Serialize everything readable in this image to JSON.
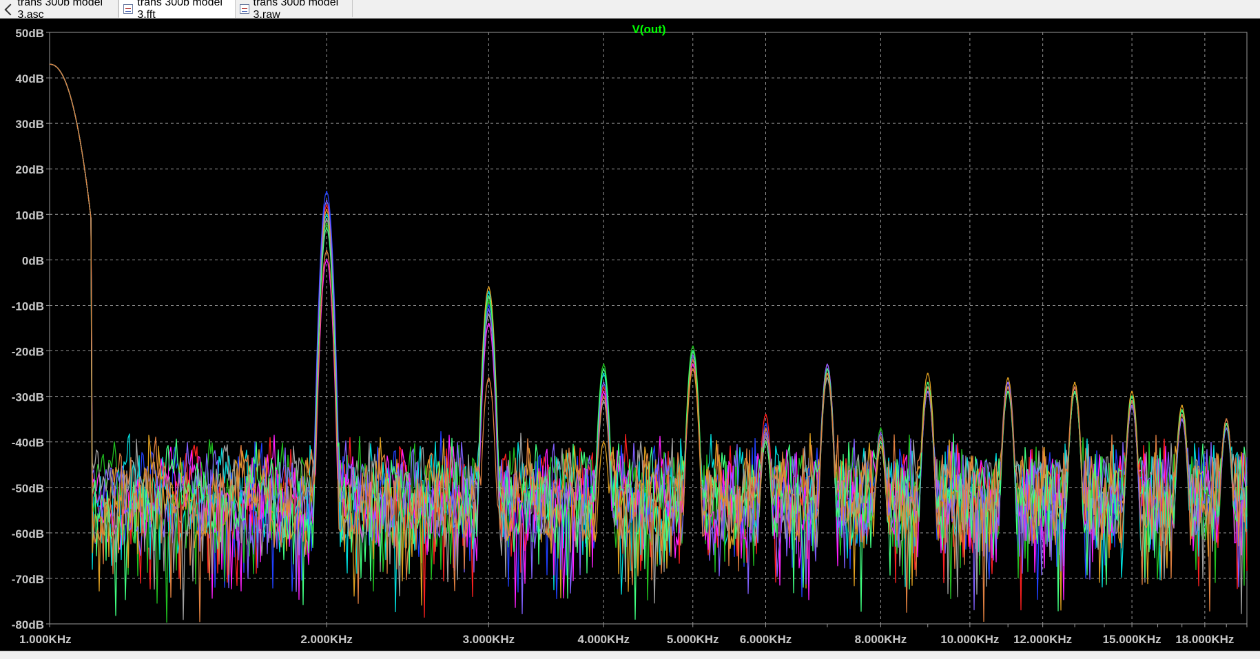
{
  "tabs": [
    {
      "label": "trans 300b model 3.asc",
      "icon": "schematic-icon",
      "active": false
    },
    {
      "label": "trans 300b model 3.fft",
      "icon": "waveform-icon",
      "active": true
    },
    {
      "label": "trans 300b model 3.raw",
      "icon": "waveform-icon",
      "active": false
    }
  ],
  "colors": {
    "background": "#000000",
    "grid": "#9a9a9a",
    "axis_text": "#c8c8c8",
    "title": "#00ff00",
    "series": [
      "#ff2020",
      "#2040ff",
      "#00e0e0",
      "#20c020",
      "#ff20ff",
      "#e0a020",
      "#a0a0a0",
      "#8060ff",
      "#40ff80",
      "#e08040"
    ]
  },
  "chart_data": {
    "type": "line",
    "title": "V(out)",
    "xscale": "log",
    "xlim": [
      1000,
      20000
    ],
    "ylim": [
      -80,
      50
    ],
    "grid": true,
    "y_ticks": [
      50,
      40,
      30,
      20,
      10,
      0,
      -10,
      -20,
      -30,
      -40,
      -50,
      -60,
      -70,
      -80
    ],
    "y_tick_labels": [
      "50dB",
      "40dB",
      "30dB",
      "20dB",
      "10dB",
      "0dB",
      "-10dB",
      "-20dB",
      "-30dB",
      "-40dB",
      "-50dB",
      "-60dB",
      "-70dB",
      "-80dB"
    ],
    "x_ticks": [
      1000,
      2000,
      3000,
      4000,
      5000,
      6000,
      8000,
      10000,
      12000,
      15000,
      18000
    ],
    "x_tick_labels": [
      "1.000KHz",
      "2.000KHz",
      "3.000KHz",
      "4.000KHz",
      "5.000KHz",
      "6.000KHz",
      "8.000KHz",
      "10.000KHz",
      "12.000KHz",
      "15.000KHz",
      "18.000KHz"
    ],
    "fundamental": {
      "x": 1000,
      "y": 43
    },
    "noise_floor": -52,
    "harmonics": [
      {
        "x": 2000,
        "y": [
          12,
          15,
          10,
          8,
          0,
          11,
          9,
          13,
          7,
          2
        ]
      },
      {
        "x": 3000,
        "y": [
          -8,
          -10,
          -7,
          -9,
          -14,
          -6,
          -12,
          -11,
          -8,
          -26
        ]
      },
      {
        "x": 4000,
        "y": [
          -28,
          -30,
          -25,
          -23,
          -29,
          -40,
          -31,
          -27,
          -24,
          -30
        ]
      },
      {
        "x": 5000,
        "y": [
          -21,
          -22,
          -20,
          -19,
          -23,
          -24,
          -22,
          -21,
          -20,
          -22
        ]
      },
      {
        "x": 6000,
        "y": [
          -34,
          -36,
          -38,
          -40,
          -38,
          -40,
          -39,
          -38,
          -40,
          -37
        ]
      },
      {
        "x": 7000,
        "y": [
          -23,
          -24,
          -25,
          -26,
          -24,
          -25,
          -26,
          -23,
          -24,
          -25
        ]
      },
      {
        "x": 8000,
        "y": [
          -38,
          -39,
          -40,
          -37,
          -40,
          -41,
          -39,
          -38,
          -40,
          -39
        ]
      },
      {
        "x": 9000,
        "y": [
          -27,
          -28,
          -29,
          -27,
          -28,
          -25,
          -28,
          -29,
          -27,
          -28
        ]
      },
      {
        "x": 11000,
        "y": [
          -28,
          -29,
          -27,
          -28,
          -27,
          -26,
          -28,
          -27,
          -29,
          -28
        ]
      },
      {
        "x": 13000,
        "y": [
          -28,
          -28,
          -29,
          -29,
          -28,
          -27,
          -29,
          -28,
          -29,
          -28
        ]
      },
      {
        "x": 15000,
        "y": [
          -32,
          -31,
          -32,
          -30,
          -31,
          -29,
          -31,
          -32,
          -30,
          -31
        ]
      },
      {
        "x": 17000,
        "y": [
          -33,
          -34,
          -35,
          -33,
          -34,
          -32,
          -34,
          -35,
          -33,
          -34
        ]
      },
      {
        "x": 19000,
        "y": [
          -36,
          -35,
          -36,
          -37,
          -36,
          -35,
          -36,
          -37,
          -36,
          -35
        ]
      }
    ]
  }
}
